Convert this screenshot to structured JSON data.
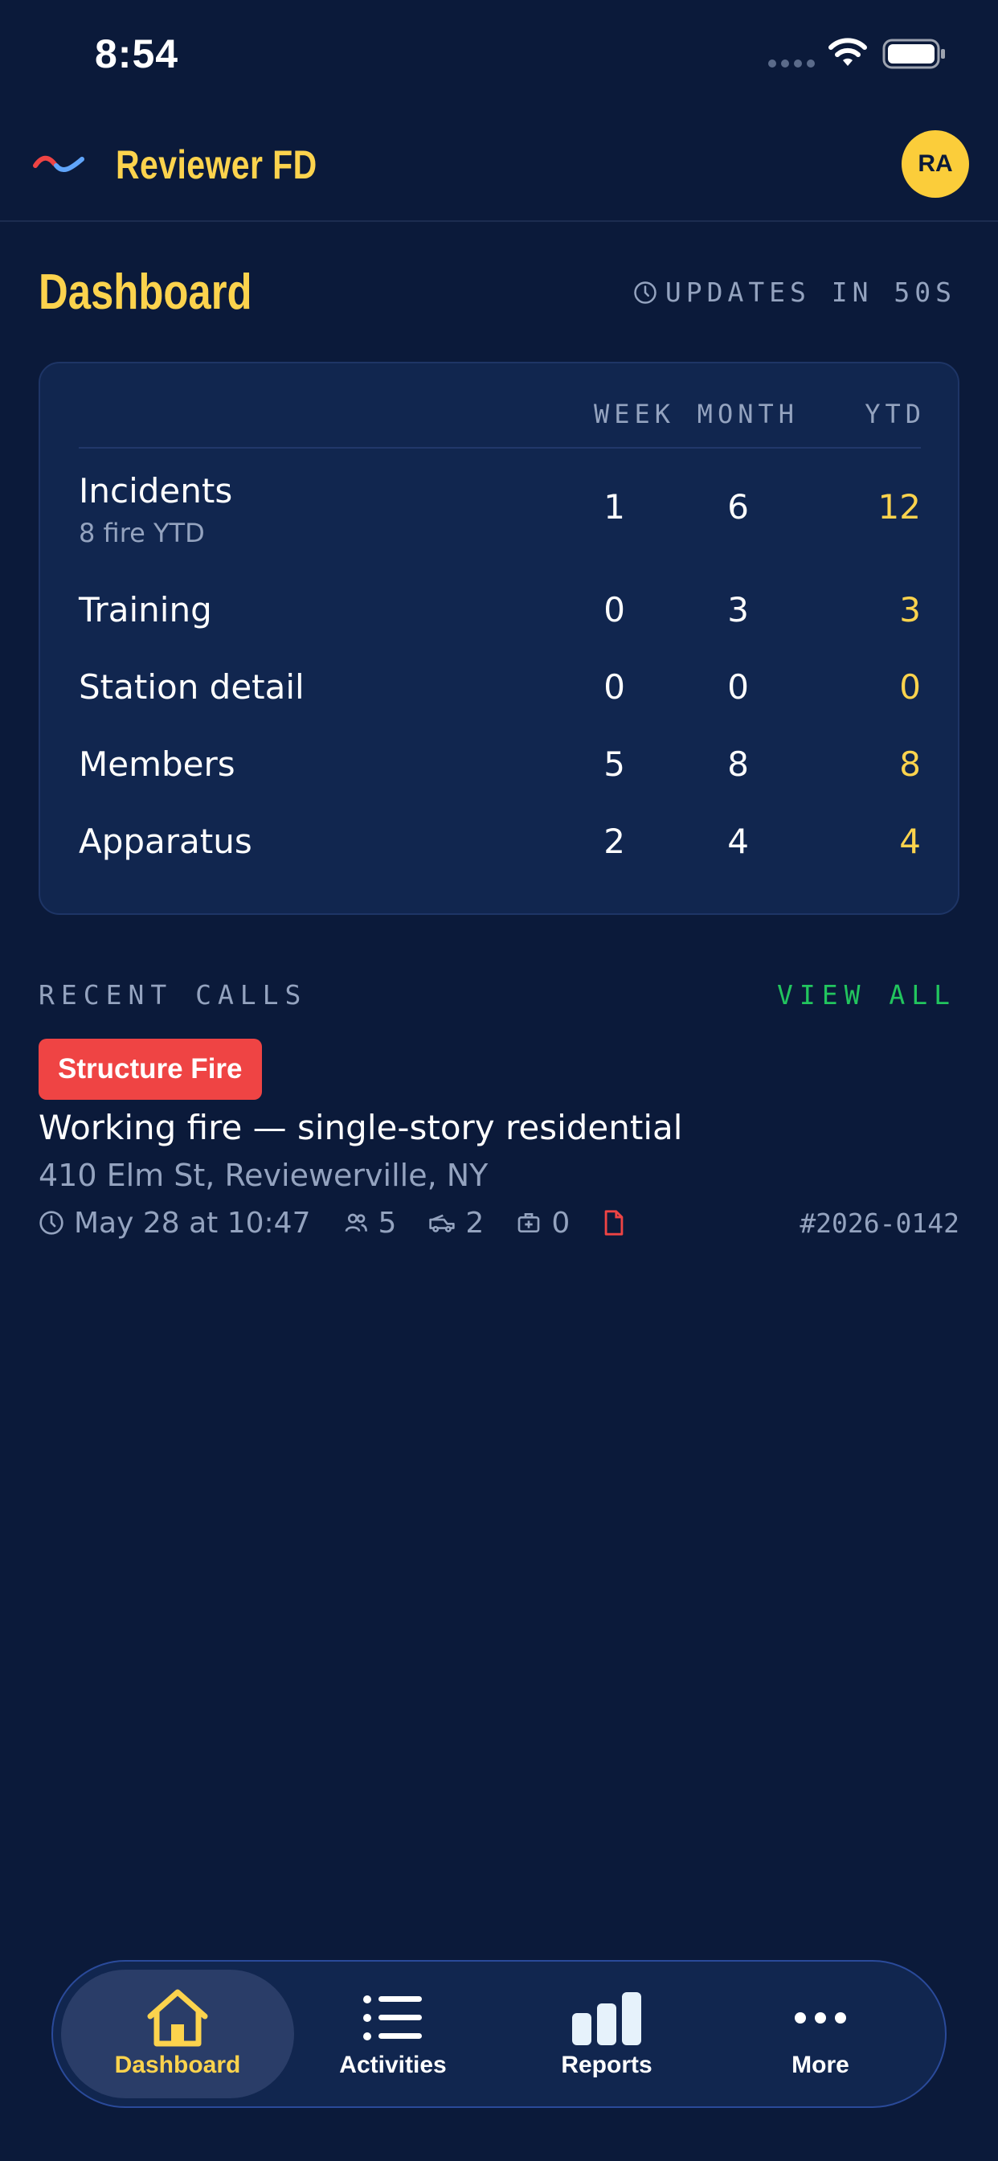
{
  "status_bar": {
    "time": "8:54",
    "icons": [
      "cellular-signal-icon",
      "wifi-icon",
      "battery-icon"
    ]
  },
  "header": {
    "app_name": "Reviewer FD",
    "avatar_initials": "RA",
    "logo_icon": "wave-logo-icon"
  },
  "dashboard": {
    "title": "Dashboard",
    "updates_text": "UPDATES IN 50S",
    "columns": [
      "WEEK",
      "MONTH",
      "YTD"
    ],
    "rows": [
      {
        "label": "Incidents",
        "sub": "8 fire YTD",
        "week": "1",
        "month": "6",
        "ytd": "12"
      },
      {
        "label": "Training",
        "week": "0",
        "month": "3",
        "ytd": "3"
      },
      {
        "label": "Station detail",
        "week": "0",
        "month": "0",
        "ytd": "0"
      },
      {
        "label": "Members",
        "week": "5",
        "month": "8",
        "ytd": "8"
      },
      {
        "label": "Apparatus",
        "week": "2",
        "month": "4",
        "ytd": "4"
      }
    ]
  },
  "recent_calls": {
    "section_label": "RECENT CALLS",
    "view_all": "VIEW ALL",
    "calls": [
      {
        "type": "Structure Fire",
        "title": "Working fire — single-story residential",
        "address": "410 Elm St, Reviewerville, NY",
        "datetime": "May 28 at 10:47",
        "members": "5",
        "apparatus": "2",
        "patients": "0",
        "number": "#2026-0142"
      }
    ]
  },
  "tab_bar": {
    "tabs": [
      {
        "label": "Dashboard",
        "icon": "home-icon",
        "active": true
      },
      {
        "label": "Activities",
        "icon": "list-icon",
        "active": false
      },
      {
        "label": "Reports",
        "icon": "bar-chart-icon",
        "active": false
      },
      {
        "label": "More",
        "icon": "more-dots-icon",
        "active": false
      }
    ]
  },
  "colors": {
    "background": "#0b1a3a",
    "card": "#11264f",
    "accent_yellow": "#fcd34d",
    "accent_green": "#22c55e",
    "badge_red": "#ef4444",
    "muted_text": "#94a3bf"
  }
}
